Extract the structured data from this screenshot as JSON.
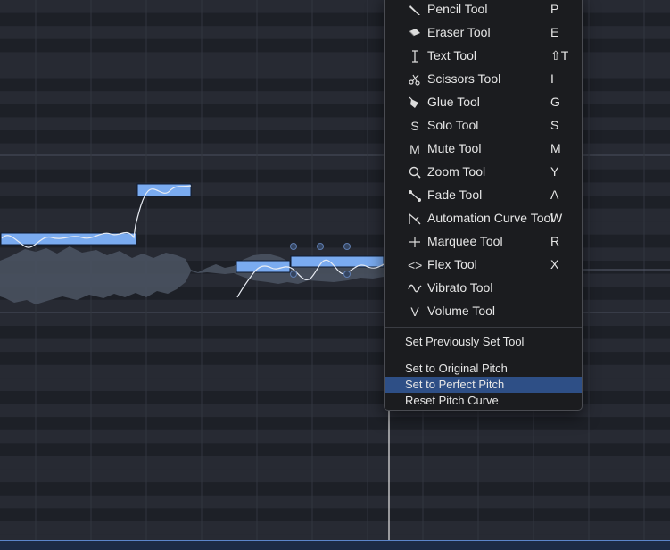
{
  "tool_menu": {
    "tools": [
      {
        "icon": "pencil-icon",
        "label": "Pencil Tool",
        "shortcut": "P"
      },
      {
        "icon": "eraser-icon",
        "label": "Eraser Tool",
        "shortcut": "E"
      },
      {
        "icon": "text-cursor-icon",
        "label": "Text Tool",
        "shortcut": "⇧T"
      },
      {
        "icon": "scissors-icon",
        "label": "Scissors Tool",
        "shortcut": "I"
      },
      {
        "icon": "glue-icon",
        "label": "Glue Tool",
        "shortcut": "G"
      },
      {
        "icon": "solo-icon",
        "label": "Solo Tool",
        "shortcut": "S",
        "glyph": "S"
      },
      {
        "icon": "mute-icon",
        "label": "Mute Tool",
        "shortcut": "M",
        "glyph": "M"
      },
      {
        "icon": "zoom-icon",
        "label": "Zoom Tool",
        "shortcut": "Y"
      },
      {
        "icon": "fade-icon",
        "label": "Fade Tool",
        "shortcut": "A"
      },
      {
        "icon": "automation-curve-icon",
        "label": "Automation Curve Tool",
        "shortcut": "W"
      },
      {
        "icon": "marquee-icon",
        "label": "Marquee Tool",
        "shortcut": "R"
      },
      {
        "icon": "flex-icon",
        "label": "Flex Tool",
        "shortcut": "X",
        "glyph": "<>"
      },
      {
        "icon": "vibrato-icon",
        "label": "Vibrato Tool",
        "shortcut": ""
      },
      {
        "icon": "volume-icon",
        "label": "Volume Tool",
        "shortcut": "",
        "glyph": "V"
      }
    ],
    "set_previous": "Set Previously Set Tool",
    "pitch_actions": [
      {
        "label": "Set to Original Pitch",
        "highlighted": false
      },
      {
        "label": "Set to Perfect Pitch",
        "highlighted": true
      },
      {
        "label": "Reset Pitch Curve",
        "highlighted": false
      }
    ]
  },
  "colors": {
    "background": "#24272f",
    "note": "#7aabf0",
    "waveform": "#4a5260",
    "highlight": "#2e4f86",
    "menu": "#1b1c1f"
  }
}
